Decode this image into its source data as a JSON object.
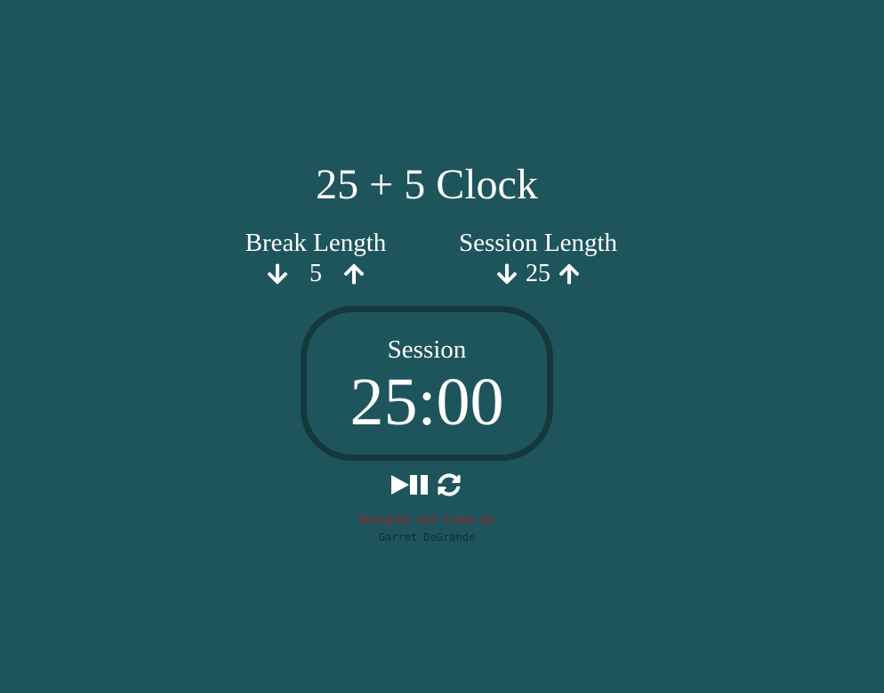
{
  "app": {
    "title": "25 + 5 Clock"
  },
  "break": {
    "label": "Break Length",
    "value": "5",
    "decrement_icon": "arrow-down-icon",
    "increment_icon": "arrow-up-icon"
  },
  "session": {
    "label": "Session Length",
    "value": "25",
    "decrement_icon": "arrow-down-icon",
    "increment_icon": "arrow-up-icon"
  },
  "timer": {
    "label": "Session",
    "time_left": "25:00"
  },
  "controls": {
    "start_stop_icon": "play-pause-icon",
    "reset_icon": "refresh-icon"
  },
  "credit": {
    "line1": "Designed and Coded by",
    "line2": "Garret DeGrande"
  },
  "colors": {
    "background": "#1e555c",
    "timer_border": "#13393e",
    "credit_line1": "#a3232a",
    "credit_line2": "#0d2b3c",
    "text": "#ffffff"
  }
}
